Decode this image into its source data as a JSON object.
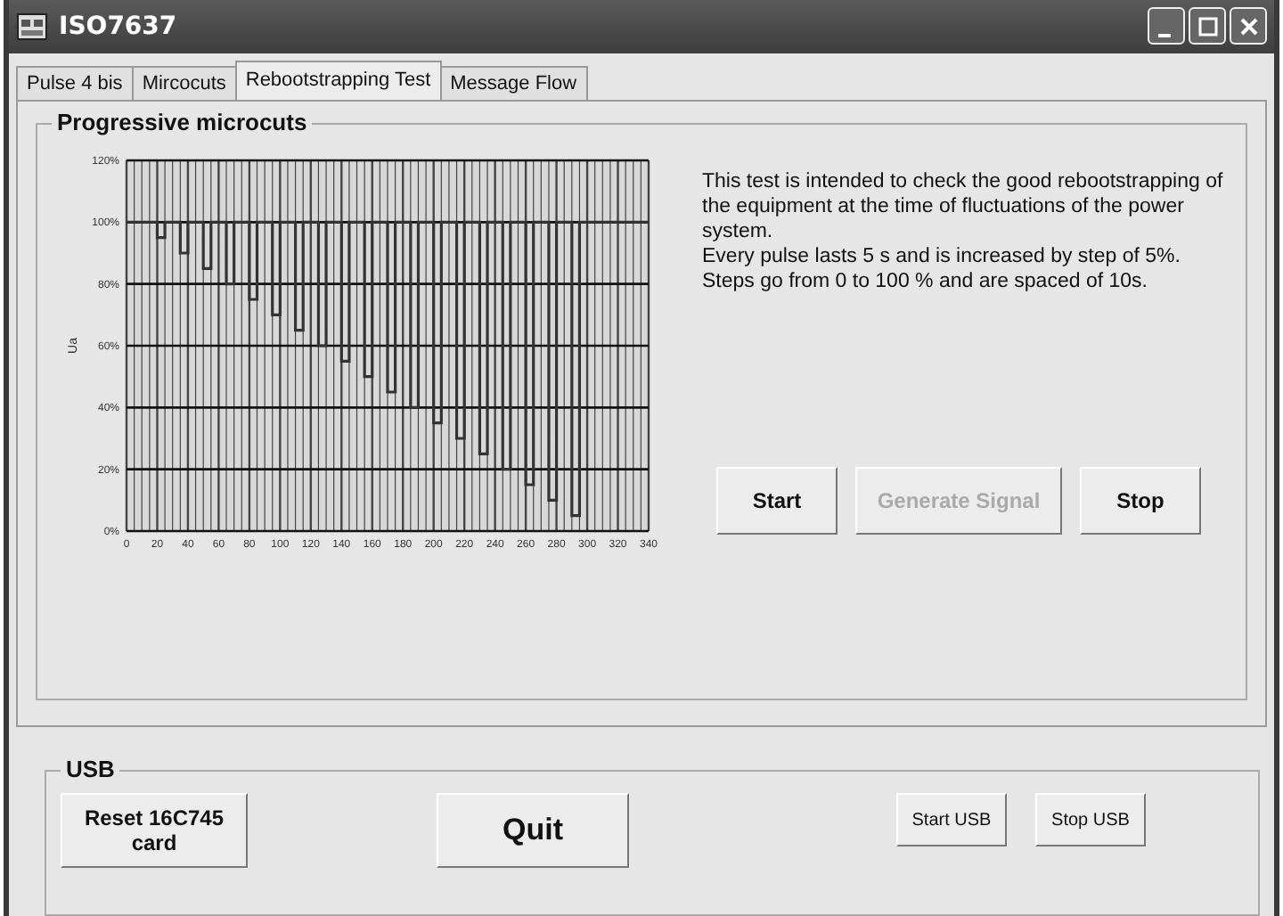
{
  "window": {
    "title": "ISO7637"
  },
  "tabs": [
    {
      "label": "Pulse 4 bis",
      "selected": false
    },
    {
      "label": "Mircocuts",
      "selected": false
    },
    {
      "label": "Rebootstrapping Test",
      "selected": true
    },
    {
      "label": "Message Flow",
      "selected": false
    }
  ],
  "group": {
    "title": "Progressive microcuts",
    "chart_data": {
      "type": "line",
      "ylabel": "Ua",
      "xlim": [
        0,
        340
      ],
      "ylim": [
        0,
        120
      ],
      "xticks": [
        0,
        20,
        40,
        60,
        80,
        100,
        120,
        140,
        160,
        180,
        200,
        220,
        240,
        260,
        280,
        300,
        320,
        340
      ],
      "yticks": [
        {
          "value": 0,
          "label": "0%"
        },
        {
          "value": 20,
          "label": "20%"
        },
        {
          "value": 40,
          "label": "40%"
        },
        {
          "value": 60,
          "label": "60%"
        },
        {
          "value": 80,
          "label": "80%"
        },
        {
          "value": 100,
          "label": "100%"
        },
        {
          "value": 120,
          "label": "120%"
        }
      ],
      "x": [
        0,
        20,
        20,
        25,
        25,
        35,
        35,
        40,
        40,
        50,
        50,
        55,
        55,
        65,
        65,
        70,
        70,
        80,
        80,
        85,
        85,
        95,
        95,
        100,
        100,
        110,
        110,
        115,
        115,
        125,
        125,
        130,
        130,
        140,
        140,
        145,
        145,
        155,
        155,
        160,
        160,
        170,
        170,
        175,
        175,
        185,
        185,
        190,
        190,
        200,
        200,
        205,
        205,
        215,
        215,
        220,
        220,
        230,
        230,
        235,
        235,
        245,
        245,
        250,
        250,
        260,
        260,
        265,
        265,
        275,
        275,
        280,
        280,
        290,
        290,
        295,
        295,
        340
      ],
      "grid": true,
      "series": [
        {
          "color": "#333333",
          "values": [
            100,
            100,
            95,
            95,
            100,
            100,
            90,
            90,
            100,
            100,
            85,
            85,
            100,
            100,
            80,
            80,
            100,
            100,
            75,
            75,
            100,
            100,
            70,
            70,
            100,
            100,
            65,
            65,
            100,
            100,
            60,
            60,
            100,
            100,
            55,
            55,
            100,
            100,
            50,
            50,
            100,
            100,
            45,
            45,
            100,
            100,
            40,
            40,
            100,
            100,
            35,
            35,
            100,
            100,
            30,
            30,
            100,
            100,
            25,
            25,
            100,
            100,
            20,
            20,
            100,
            100,
            15,
            15,
            100,
            100,
            10,
            10,
            100,
            100,
            5,
            5,
            100,
            100
          ]
        }
      ]
    },
    "description": [
      "This test is intended to check the good rebootstrapping of the equipment at the time of fluctuations of the power system.",
      "Every pulse lasts 5 s and is increased by step of 5%.",
      "Steps go from 0 to 100 % and are spaced of 10s."
    ],
    "buttons": [
      {
        "label": "Start",
        "disabled": false
      },
      {
        "label": "Generate Signal",
        "disabled": true
      },
      {
        "label": "Stop",
        "disabled": false
      }
    ]
  },
  "usb": {
    "title": "USB",
    "reset_button": "Reset 16C745 card",
    "quit_button": "Quit",
    "start_button": "Start USB",
    "stop_button": "Stop USB"
  }
}
